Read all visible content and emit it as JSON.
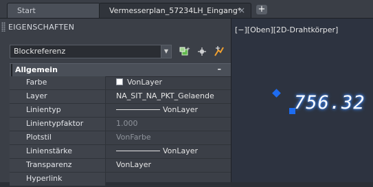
{
  "tabs": [
    {
      "label": "Start"
    },
    {
      "label": "Vermesserplan_57234LH_Eingang*"
    }
  ],
  "tab_close_symbol": "×",
  "add_tab_symbol": "+",
  "panel": {
    "title": "EIGENSCHAFTEN",
    "selection": "Blockreferenz",
    "section_label": "Allgemein",
    "section_toggle": "–",
    "properties": [
      {
        "name": "Farbe",
        "value": "VonLayer"
      },
      {
        "name": "Layer",
        "value": "NA_SIT_NA_PKT_Gelaende"
      },
      {
        "name": "Linientyp",
        "value": "VonLayer"
      },
      {
        "name": "Linientypfaktor",
        "value": "1.000"
      },
      {
        "name": "Plotstil",
        "value": "VonFarbe"
      },
      {
        "name": "Linienstärke",
        "value": "VonLayer"
      },
      {
        "name": "Transparenz",
        "value": "VonLayer"
      },
      {
        "name": "Hyperlink",
        "value": ""
      }
    ]
  },
  "viewport": {
    "label": "[−][Oben][2D-Drahtkörper]",
    "text": "756.32"
  },
  "colors": {
    "grip": "#1e6cf0",
    "text_glow": "#3f8cff"
  }
}
